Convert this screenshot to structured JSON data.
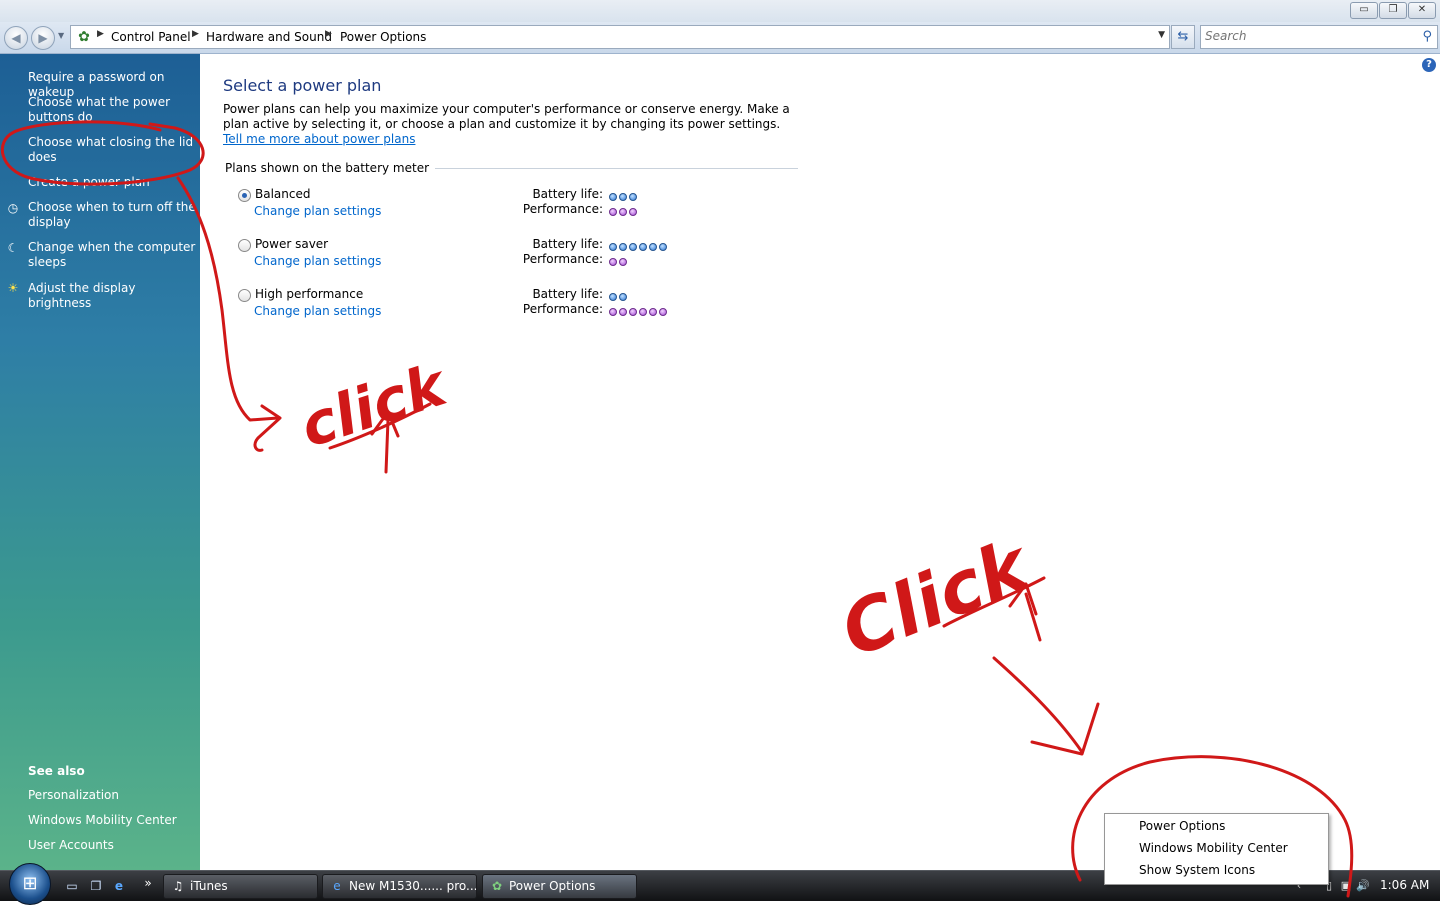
{
  "window": {
    "buttons": {
      "minimize": "▭",
      "restore": "❐",
      "close": "✕"
    }
  },
  "address_bar": {
    "breadcrumbs": [
      "Control Panel",
      "Hardware and Sound",
      "Power Options"
    ],
    "search_placeholder": "Search",
    "icons": {
      "back": "back-arrow-icon",
      "forward": "forward-arrow-icon",
      "refresh": "refresh-icon",
      "search": "search-icon"
    }
  },
  "sidebar": {
    "tasks": [
      {
        "label": "Require a password on wakeup",
        "icon": ""
      },
      {
        "label": "Choose what the power buttons do",
        "icon": ""
      },
      {
        "label": "Choose what closing the lid does",
        "icon": ""
      },
      {
        "label": "Create a power plan",
        "icon": ""
      },
      {
        "label": "Choose when to turn off the display",
        "icon": "display-clock-icon"
      },
      {
        "label": "Change when the computer sleeps",
        "icon": "moon-icon"
      },
      {
        "label": "Adjust the display brightness",
        "icon": "sun-icon"
      }
    ],
    "see_also_heading": "See also",
    "see_also": [
      "Personalization",
      "Windows Mobility Center",
      "User Accounts"
    ]
  },
  "main": {
    "title": "Select a power plan",
    "intro_text": "Power plans can help you maximize your computer's performance or conserve energy. Make a plan active by selecting it, or choose a plan and customize it by changing its power settings.",
    "intro_link": "Tell me more about power plans",
    "group_label": "Plans shown on the battery meter",
    "battery_label": "Battery life:",
    "performance_label": "Performance:",
    "plans": [
      {
        "name": "Balanced",
        "selected": true,
        "change_link": "Change plan settings",
        "battery_life": 3,
        "performance": 3
      },
      {
        "name": "Power saver",
        "selected": false,
        "change_link": "Change plan settings",
        "battery_life": 6,
        "performance": 2
      },
      {
        "name": "High performance",
        "selected": false,
        "change_link": "Change plan settings",
        "battery_life": 2,
        "performance": 6
      }
    ]
  },
  "context_menu": {
    "items": [
      "Power Options",
      "Windows Mobility Center",
      "Show System Icons"
    ]
  },
  "taskbar": {
    "start_icon": "windows-logo-icon",
    "quick_launch": [
      "show-desktop-icon",
      "switch-windows-icon",
      "internet-explorer-icon"
    ],
    "overflow": "»",
    "tasks": [
      {
        "label": "iTunes",
        "icon": "itunes-icon"
      },
      {
        "label": "New M1530...... pro...",
        "icon": "internet-explorer-icon"
      },
      {
        "label": "Power Options",
        "icon": "power-options-icon"
      }
    ],
    "tray_icons": [
      "show-hidden-icon",
      "network-icon",
      "battery-icon",
      "volume-icon"
    ],
    "clock": "1:06 AM"
  },
  "annotations": {
    "color": "#d01818",
    "words": [
      "click",
      "Click"
    ]
  },
  "colors": {
    "link": "#0066cc",
    "title": "#1e3a80",
    "battery_dot": "#2f77d6",
    "performance_dot": "#a14ad3"
  }
}
